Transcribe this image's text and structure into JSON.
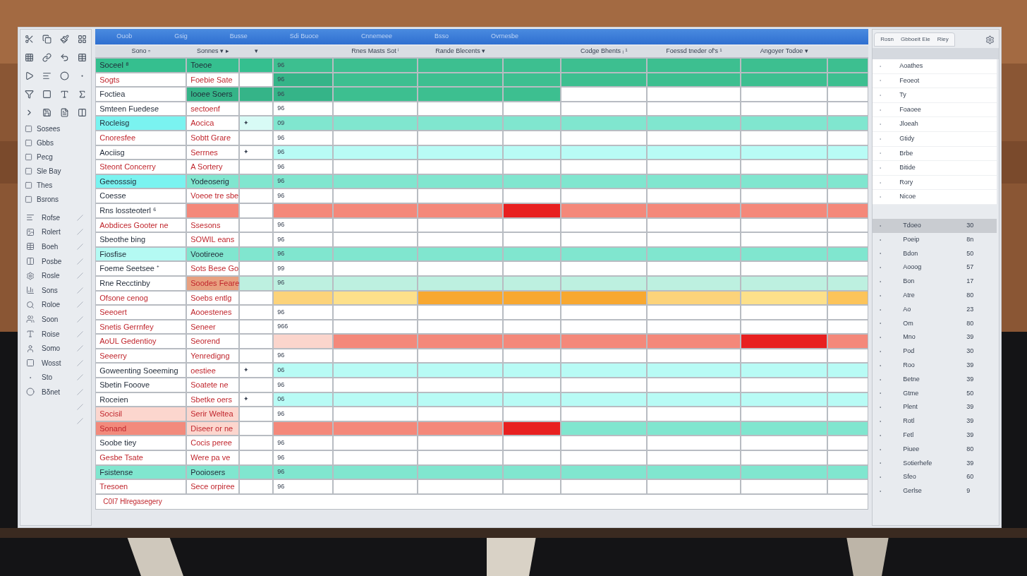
{
  "ribbon": {
    "items": [
      "Ouob",
      "Gsig",
      "Busse",
      "Sdi Buoce",
      "Cnnemeee",
      "Bsso",
      "Ovrnesbe"
    ]
  },
  "toolbox": {
    "labels": [
      "Sosees",
      "Gbbs",
      "Pecg",
      "Sle Bay",
      "Thes",
      "Bsrons"
    ],
    "items": [
      {
        "kind": "entry",
        "label": "Rofse"
      },
      {
        "kind": "entry",
        "label": "Rolert"
      },
      {
        "kind": "entry",
        "label": "Boeh"
      },
      {
        "kind": "entry",
        "label": "Posbe"
      },
      {
        "kind": "entry",
        "label": "Rosle"
      },
      {
        "kind": "entry",
        "label": "Sons"
      },
      {
        "kind": "entry",
        "label": "Roloe"
      },
      {
        "kind": "entry",
        "label": "Soon"
      },
      {
        "kind": "entry",
        "label": "Roise"
      },
      {
        "kind": "entry",
        "label": "Somo"
      },
      {
        "kind": "entry",
        "label": "Wosst"
      },
      {
        "kind": "entry",
        "label": "Sto"
      },
      {
        "kind": "entry",
        "label": "Bδnet"
      },
      {
        "kind": "blank"
      },
      {
        "kind": "blank"
      }
    ]
  },
  "table": {
    "columns": [
      {
        "label": "Sono ▫"
      },
      {
        "label": "Sonnes ▾ ▸"
      },
      {
        "label": "▾"
      },
      {},
      {
        "label": "Rnes Masts Sot ⁱ"
      },
      {
        "label": "Rande Blecents ▾"
      },
      {},
      {
        "label": "Codge Bhents ᵢ ¹"
      },
      {
        "label": "Foessd tneder of's ¹"
      },
      {
        "label": "Angoyer Todoe ▾"
      },
      {}
    ],
    "rows": [
      {
        "cells": [
          {
            "text": "Soceel ⁸",
            "alert": false,
            "color": "#35bf8f"
          },
          {
            "text": "Toeoe",
            "alert": false,
            "color": "#35bf8f"
          },
          {
            "color": "#35bf8f"
          },
          {
            "text": "96",
            "color": "#3dbf90"
          },
          {
            "color": "#3dbf90"
          },
          {
            "color": "#3dbf90"
          },
          {
            "color": "#3dbf90"
          },
          {
            "color": "#3dbf90"
          },
          {
            "color": "#3dbf90"
          },
          {
            "color": "#3dbf90"
          },
          {
            "color": "#3dbf90"
          }
        ]
      },
      {
        "cells": [
          {
            "text": "Sogts",
            "alert": true,
            "color": "#ffffff"
          },
          {
            "text": "Foebie Sate",
            "alert": true,
            "color": "#ffffff"
          },
          {
            "color": "#ffffff"
          },
          {
            "text": "96",
            "color": "#35b488"
          },
          {
            "color": "#3dbf90"
          },
          {
            "color": "#3dbf90"
          },
          {
            "color": "#3dbf90"
          },
          {
            "color": "#3dbf90"
          },
          {
            "color": "#3dbf90"
          },
          {
            "color": "#3dbf90"
          },
          {
            "color": "#3dbf90"
          }
        ]
      },
      {
        "cells": [
          {
            "text": "Foctiea",
            "alert": false,
            "color": "#ffffff"
          },
          {
            "text": "Iooee Soers",
            "alert": false,
            "color": "#35b488"
          },
          {
            "color": "#35b488"
          },
          {
            "text": "96",
            "color": "#35b488"
          },
          {
            "color": "#3dbf90"
          },
          {
            "color": "#3dbf90"
          },
          {
            "color": "#3dbf90"
          },
          {
            "color": "#ffffff"
          },
          {
            "color": "#ffffff"
          },
          {
            "color": "#ffffff"
          },
          {
            "color": "#ffffff"
          }
        ]
      },
      {
        "cells": [
          {
            "text": "Smteen Fuedese",
            "alert": false,
            "color": "#ffffff"
          },
          {
            "text": "sectoenf",
            "alert": true,
            "color": "#ffffff"
          },
          {
            "color": "#ffffff"
          },
          {
            "text": "96",
            "color": "#ffffff"
          },
          {
            "color": "#ffffff"
          },
          {
            "color": "#ffffff"
          },
          {
            "color": "#ffffff"
          },
          {
            "color": "#ffffff"
          },
          {
            "color": "#ffffff"
          },
          {
            "color": "#ffffff"
          },
          {
            "color": "#ffffff"
          }
        ]
      },
      {
        "cells": [
          {
            "text": "Rocleisg",
            "alert": false,
            "color": "#7af3f0"
          },
          {
            "text": "Aocica",
            "alert": true,
            "color": "#ffffff"
          },
          {
            "text": "✦",
            "color": "#d8fbf6"
          },
          {
            "text": "09",
            "color": "#80e6cf"
          },
          {
            "color": "#80e6cf"
          },
          {
            "color": "#80e6cf"
          },
          {
            "color": "#80e6cf"
          },
          {
            "color": "#80e6cf"
          },
          {
            "color": "#80e6cf"
          },
          {
            "color": "#80e6cf"
          },
          {
            "color": "#80e6cf"
          }
        ]
      },
      {
        "cells": [
          {
            "text": "Cnoresfee",
            "alert": true,
            "color": "#ffffff"
          },
          {
            "text": "Sobtt Grare",
            "alert": true,
            "color": "#ffffff"
          },
          {
            "color": "#ffffff"
          },
          {
            "text": "96",
            "color": "#ffffff"
          },
          {
            "color": "#ffffff"
          },
          {
            "color": "#ffffff"
          },
          {
            "color": "#ffffff"
          },
          {
            "color": "#ffffff"
          },
          {
            "color": "#ffffff"
          },
          {
            "color": "#ffffff"
          },
          {
            "color": "#ffffff"
          }
        ]
      },
      {
        "cells": [
          {
            "text": "Aociisg",
            "alert": false,
            "color": "#ffffff"
          },
          {
            "text": "Serrnes",
            "alert": true,
            "color": "#ffffff"
          },
          {
            "text": "✦",
            "color": "#ffffff"
          },
          {
            "text": "96",
            "color": "#b8fbf5"
          },
          {
            "color": "#b8fbf5"
          },
          {
            "color": "#b8fbf5"
          },
          {
            "color": "#b8fbf5"
          },
          {
            "color": "#b8fbf5"
          },
          {
            "color": "#b8fbf5"
          },
          {
            "color": "#b8fbf5"
          },
          {
            "color": "#b8fbf5"
          }
        ]
      },
      {
        "cells": [
          {
            "text": "Steont Concerry",
            "alert": true,
            "color": "#ffffff"
          },
          {
            "text": "A Sortery",
            "alert": true,
            "color": "#ffffff"
          },
          {
            "color": "#ffffff"
          },
          {
            "text": "96",
            "color": "#ffffff"
          },
          {
            "color": "#ffffff"
          },
          {
            "color": "#ffffff"
          },
          {
            "color": "#ffffff"
          },
          {
            "color": "#ffffff"
          },
          {
            "color": "#ffffff"
          },
          {
            "color": "#ffffff"
          },
          {
            "color": "#ffffff"
          }
        ]
      },
      {
        "cells": [
          {
            "text": "Geeosssig",
            "alert": false,
            "color": "#7af3f0"
          },
          {
            "text": "Yodeoserig",
            "alert": false,
            "color": "#80e6cf"
          },
          {
            "color": "#80e6cf"
          },
          {
            "text": "96",
            "color": "#80e6cf"
          },
          {
            "color": "#80e6cf"
          },
          {
            "color": "#80e6cf"
          },
          {
            "color": "#80e6cf"
          },
          {
            "color": "#80e6cf"
          },
          {
            "color": "#80e6cf"
          },
          {
            "color": "#80e6cf"
          },
          {
            "color": "#80e6cf"
          }
        ]
      },
      {
        "cells": [
          {
            "text": "Coesse",
            "alert": false,
            "color": "#ffffff"
          },
          {
            "text": "Voeoe tre sbe",
            "alert": true,
            "color": "#ffffff"
          },
          {
            "color": "#ffffff"
          },
          {
            "text": "96",
            "color": "#ffffff"
          },
          {
            "color": "#ffffff"
          },
          {
            "color": "#ffffff"
          },
          {
            "color": "#ffffff"
          },
          {
            "color": "#ffffff"
          },
          {
            "color": "#ffffff"
          },
          {
            "color": "#ffffff"
          },
          {
            "color": "#ffffff"
          }
        ]
      },
      {
        "cells": [
          {
            "text": "Rns lossteoterl ⁶",
            "alert": false,
            "color": "#ffffff"
          },
          {
            "color": "#f4887a"
          },
          {
            "color": "#ffffff"
          },
          {
            "color": "#f4887a"
          },
          {
            "color": "#f4887a"
          },
          {
            "color": "#f4887a"
          },
          {
            "color": "#e82020"
          },
          {
            "color": "#f4887a"
          },
          {
            "color": "#f4887a"
          },
          {
            "color": "#f4887a"
          },
          {
            "color": "#f4887a"
          }
        ]
      },
      {
        "cells": [
          {
            "text": "Aobdices Gooter ne",
            "alert": true,
            "color": "#ffffff"
          },
          {
            "text": "Ssesons",
            "alert": true,
            "color": "#ffffff"
          },
          {
            "color": "#ffffff"
          },
          {
            "text": "96",
            "color": "#ffffff"
          },
          {
            "color": "#ffffff"
          },
          {
            "color": "#ffffff"
          },
          {
            "color": "#ffffff"
          },
          {
            "color": "#ffffff"
          },
          {
            "color": "#ffffff"
          },
          {
            "color": "#ffffff"
          },
          {
            "color": "#ffffff"
          }
        ]
      },
      {
        "cells": [
          {
            "text": "Sbeothe bing",
            "alert": false,
            "color": "#ffffff"
          },
          {
            "text": "SOWIL eans",
            "alert": true,
            "color": "#ffffff"
          },
          {
            "color": "#ffffff"
          },
          {
            "text": "96",
            "color": "#ffffff"
          },
          {
            "color": "#ffffff"
          },
          {
            "color": "#ffffff"
          },
          {
            "color": "#ffffff"
          },
          {
            "color": "#ffffff"
          },
          {
            "color": "#ffffff"
          },
          {
            "color": "#ffffff"
          },
          {
            "color": "#ffffff"
          }
        ]
      },
      {
        "cells": [
          {
            "text": "Fiosfise",
            "alert": false,
            "color": "#b4faf3"
          },
          {
            "text": "Vootireoe",
            "alert": false,
            "color": "#80e6cf"
          },
          {
            "color": "#80e6cf"
          },
          {
            "text": "96",
            "color": "#80e6cf"
          },
          {
            "color": "#80e6cf"
          },
          {
            "color": "#80e6cf"
          },
          {
            "color": "#80e6cf"
          },
          {
            "color": "#80e6cf"
          },
          {
            "color": "#80e6cf"
          },
          {
            "color": "#80e6cf"
          },
          {
            "color": "#80e6cf"
          }
        ]
      },
      {
        "cells": [
          {
            "text": "Foeme Seetsee ⁺",
            "alert": false,
            "color": "#ffffff"
          },
          {
            "text": "Sots Bese Go",
            "alert": true,
            "color": "#ffffff"
          },
          {
            "color": "#ffffff"
          },
          {
            "text": "99",
            "color": "#ffffff"
          },
          {
            "color": "#ffffff"
          },
          {
            "color": "#ffffff"
          },
          {
            "color": "#ffffff"
          },
          {
            "color": "#ffffff"
          },
          {
            "color": "#ffffff"
          },
          {
            "color": "#ffffff"
          },
          {
            "color": "#ffffff"
          }
        ]
      },
      {
        "cells": [
          {
            "text": "Rne Recctinby",
            "alert": false,
            "color": "#ffffff"
          },
          {
            "text": "Soodes Feare",
            "alert": true,
            "color": "#e8a080"
          },
          {
            "color": "#bdf0e0"
          },
          {
            "text": "96",
            "color": "#bdf0e0"
          },
          {
            "color": "#bdf0e0"
          },
          {
            "color": "#bdf0e0"
          },
          {
            "color": "#bdf0e0"
          },
          {
            "color": "#bdf0e0"
          },
          {
            "color": "#bdf0e0"
          },
          {
            "color": "#bdf0e0"
          },
          {
            "color": "#bdf0e0"
          }
        ]
      },
      {
        "cells": [
          {
            "text": "Ofsone cenog",
            "alert": true,
            "color": "#ffffff"
          },
          {
            "text": "Soebs entlg",
            "alert": true,
            "color": "#ffffff"
          },
          {
            "color": "#ffffff"
          },
          {
            "color": "#fcd37a"
          },
          {
            "color": "#fde08a"
          },
          {
            "color": "#f8a830"
          },
          {
            "color": "#f8a830"
          },
          {
            "color": "#f8a830"
          },
          {
            "color": "#fcd37a"
          },
          {
            "color": "#fde08a"
          },
          {
            "color": "#fcc45a"
          }
        ]
      },
      {
        "cells": [
          {
            "text": "Seeoert",
            "alert": true,
            "color": "#ffffff"
          },
          {
            "text": "Aooestenes",
            "alert": true,
            "color": "#ffffff"
          },
          {
            "color": "#ffffff"
          },
          {
            "text": "96",
            "color": "#ffffff"
          },
          {
            "color": "#ffffff"
          },
          {
            "color": "#ffffff"
          },
          {
            "color": "#ffffff"
          },
          {
            "color": "#ffffff"
          },
          {
            "color": "#ffffff"
          },
          {
            "color": "#ffffff"
          },
          {
            "color": "#ffffff"
          }
        ]
      },
      {
        "cells": [
          {
            "text": "Snetis Gerrnfey",
            "alert": true,
            "color": "#ffffff"
          },
          {
            "text": "Seneer",
            "alert": true,
            "color": "#ffffff"
          },
          {
            "color": "#ffffff"
          },
          {
            "text": "966",
            "color": "#ffffff"
          },
          {
            "color": "#ffffff"
          },
          {
            "color": "#ffffff"
          },
          {
            "color": "#ffffff"
          },
          {
            "color": "#ffffff"
          },
          {
            "color": "#ffffff"
          },
          {
            "color": "#ffffff"
          },
          {
            "color": "#ffffff"
          }
        ]
      },
      {
        "cells": [
          {
            "text": "AoUL Gedentioy",
            "alert": true,
            "color": "#ffffff"
          },
          {
            "text": "Seorend",
            "alert": true,
            "color": "#ffffff"
          },
          {
            "color": "#ffffff"
          },
          {
            "color": "#fbd5cc"
          },
          {
            "color": "#f4887a"
          },
          {
            "color": "#f4887a"
          },
          {
            "color": "#f4887a"
          },
          {
            "color": "#f4887a"
          },
          {
            "color": "#f4887a"
          },
          {
            "color": "#e82020"
          },
          {
            "color": "#f4887a"
          }
        ]
      },
      {
        "cells": [
          {
            "text": "Seeerry",
            "alert": true,
            "color": "#ffffff"
          },
          {
            "text": "Yenredigng",
            "alert": true,
            "color": "#ffffff"
          },
          {
            "color": "#ffffff"
          },
          {
            "text": "96",
            "color": "#ffffff"
          },
          {
            "color": "#ffffff"
          },
          {
            "color": "#ffffff"
          },
          {
            "color": "#ffffff"
          },
          {
            "color": "#ffffff"
          },
          {
            "color": "#ffffff"
          },
          {
            "color": "#ffffff"
          },
          {
            "color": "#ffffff"
          }
        ]
      },
      {
        "cells": [
          {
            "text": "Goweenting Soeeming",
            "alert": false,
            "color": "#ffffff"
          },
          {
            "text": "oestiee",
            "alert": true,
            "color": "#ffffff"
          },
          {
            "text": "✦",
            "color": "#ffffff"
          },
          {
            "text": "06",
            "color": "#b8fbf5"
          },
          {
            "color": "#b8fbf5"
          },
          {
            "color": "#b8fbf5"
          },
          {
            "color": "#b8fbf5"
          },
          {
            "color": "#b8fbf5"
          },
          {
            "color": "#b8fbf5"
          },
          {
            "color": "#b8fbf5"
          },
          {
            "color": "#b8fbf5"
          }
        ]
      },
      {
        "cells": [
          {
            "text": "Sbetin Fooove",
            "alert": false,
            "color": "#ffffff"
          },
          {
            "text": "Soatete ne",
            "alert": true,
            "color": "#ffffff"
          },
          {
            "color": "#ffffff"
          },
          {
            "text": "96",
            "color": "#ffffff"
          },
          {
            "color": "#ffffff"
          },
          {
            "color": "#ffffff"
          },
          {
            "color": "#ffffff"
          },
          {
            "color": "#ffffff"
          },
          {
            "color": "#ffffff"
          },
          {
            "color": "#ffffff"
          },
          {
            "color": "#ffffff"
          }
        ]
      },
      {
        "cells": [
          {
            "text": "Roceien",
            "alert": false,
            "color": "#ffffff"
          },
          {
            "text": "Sbetke oers",
            "alert": true,
            "color": "#ffffff"
          },
          {
            "text": "✦",
            "color": "#ffffff"
          },
          {
            "text": "06",
            "color": "#b8fbf5"
          },
          {
            "color": "#b8fbf5"
          },
          {
            "color": "#b8fbf5"
          },
          {
            "color": "#b8fbf5"
          },
          {
            "color": "#b8fbf5"
          },
          {
            "color": "#b8fbf5"
          },
          {
            "color": "#b8fbf5"
          },
          {
            "color": "#b8fbf5"
          }
        ]
      },
      {
        "cells": [
          {
            "text": "Socisil",
            "alert": true,
            "color": "#fcd6ce"
          },
          {
            "text": "Serir Weltea",
            "alert": true,
            "color": "#fcd6ce"
          },
          {
            "color": "#ffffff"
          },
          {
            "text": "96",
            "color": "#ffffff"
          },
          {
            "color": "#ffffff"
          },
          {
            "color": "#ffffff"
          },
          {
            "color": "#ffffff"
          },
          {
            "color": "#ffffff"
          },
          {
            "color": "#ffffff"
          },
          {
            "color": "#ffffff"
          },
          {
            "color": "#ffffff"
          }
        ]
      },
      {
        "cells": [
          {
            "text": "Sonand",
            "alert": true,
            "color": "#f28a7c"
          },
          {
            "text": "Diseer or ne",
            "alert": true,
            "color": "#fcd6ce"
          },
          {
            "color": "#ffffff"
          },
          {
            "color": "#f4887a"
          },
          {
            "color": "#f4887a"
          },
          {
            "color": "#f4887a"
          },
          {
            "color": "#e82020"
          },
          {
            "color": "#80e6cf"
          },
          {
            "color": "#80e6cf"
          },
          {
            "color": "#80e6cf"
          },
          {
            "color": "#80e6cf"
          }
        ]
      },
      {
        "cells": [
          {
            "text": "Soobe tiey",
            "alert": false,
            "color": "#ffffff"
          },
          {
            "text": "Cocis peree",
            "alert": true,
            "color": "#ffffff"
          },
          {
            "color": "#ffffff"
          },
          {
            "text": "96",
            "color": "#ffffff"
          },
          {
            "color": "#ffffff"
          },
          {
            "color": "#ffffff"
          },
          {
            "color": "#ffffff"
          },
          {
            "color": "#ffffff"
          },
          {
            "color": "#ffffff"
          },
          {
            "color": "#ffffff"
          },
          {
            "color": "#ffffff"
          }
        ]
      },
      {
        "cells": [
          {
            "text": "Gesbe Tsate",
            "alert": true,
            "color": "#ffffff"
          },
          {
            "text": "Were pa ve",
            "alert": true,
            "color": "#ffffff"
          },
          {
            "color": "#ffffff"
          },
          {
            "text": "96",
            "color": "#ffffff"
          },
          {
            "color": "#ffffff"
          },
          {
            "color": "#ffffff"
          },
          {
            "color": "#ffffff"
          },
          {
            "color": "#ffffff"
          },
          {
            "color": "#ffffff"
          },
          {
            "color": "#ffffff"
          },
          {
            "color": "#ffffff"
          }
        ]
      },
      {
        "cells": [
          {
            "text": "Fsistense",
            "alert": false,
            "color": "#80e6cf"
          },
          {
            "text": "Pooiosers",
            "alert": false,
            "color": "#80e6cf"
          },
          {
            "color": "#80e6cf"
          },
          {
            "text": "96",
            "color": "#80e6cf"
          },
          {
            "color": "#80e6cf"
          },
          {
            "color": "#80e6cf"
          },
          {
            "color": "#80e6cf"
          },
          {
            "color": "#80e6cf"
          },
          {
            "color": "#80e6cf"
          },
          {
            "color": "#80e6cf"
          },
          {
            "color": "#80e6cf"
          }
        ]
      },
      {
        "cells": [
          {
            "text": "Tresoen",
            "alert": true,
            "color": "#ffffff"
          },
          {
            "text": "Sece orpiree",
            "alert": true,
            "color": "#ffffff"
          },
          {
            "color": "#ffffff"
          },
          {
            "text": "96",
            "color": "#ffffff"
          },
          {
            "color": "#ffffff"
          },
          {
            "color": "#ffffff"
          },
          {
            "color": "#ffffff"
          },
          {
            "color": "#ffffff"
          },
          {
            "color": "#ffffff"
          },
          {
            "color": "#ffffff"
          },
          {
            "color": "#ffffff"
          }
        ]
      }
    ],
    "footer": "C0I7 Hlregasegery"
  },
  "panel": {
    "tabs": [
      "Rosn",
      "Gbboeit Eie",
      "Riey"
    ],
    "list": [
      "Aoathes",
      "Feoeot",
      "Ty",
      "Foaoee",
      "Jloeah",
      "Gtidy",
      "Brbe",
      "Bitide",
      "Rory",
      "Nicoe"
    ],
    "rows": [
      {
        "name": "Tdoeo",
        "value": "30",
        "selected": true
      },
      {
        "name": "Poeip",
        "value": "8n",
        "selected": false
      },
      {
        "name": "Bdon",
        "value": "50",
        "selected": false
      },
      {
        "name": "Aooog",
        "value": "57",
        "selected": false
      },
      {
        "name": "Bon",
        "value": "17",
        "selected": false
      },
      {
        "name": "Atre",
        "value": "80",
        "selected": false
      },
      {
        "name": "Ao",
        "value": "23",
        "selected": false
      },
      {
        "name": "Om",
        "value": "80",
        "selected": false
      },
      {
        "name": "Mno",
        "value": "39",
        "selected": false
      },
      {
        "name": "Pod",
        "value": "30",
        "selected": false
      },
      {
        "name": "Roo",
        "value": "39",
        "selected": false
      },
      {
        "name": "Betne",
        "value": "39",
        "selected": false
      },
      {
        "name": "Gtme",
        "value": "50",
        "selected": false
      },
      {
        "name": "Plent",
        "value": "39",
        "selected": false
      },
      {
        "name": "Rotl",
        "value": "39",
        "selected": false
      },
      {
        "name": "Fetl",
        "value": "39",
        "selected": false
      },
      {
        "name": "Piuee",
        "value": "80",
        "selected": false
      },
      {
        "name": "Sotierhefe",
        "value": "39",
        "selected": false
      },
      {
        "name": "Sfeo",
        "value": "60",
        "selected": false
      },
      {
        "name": "Gerlse",
        "value": "9",
        "selected": false
      }
    ]
  }
}
